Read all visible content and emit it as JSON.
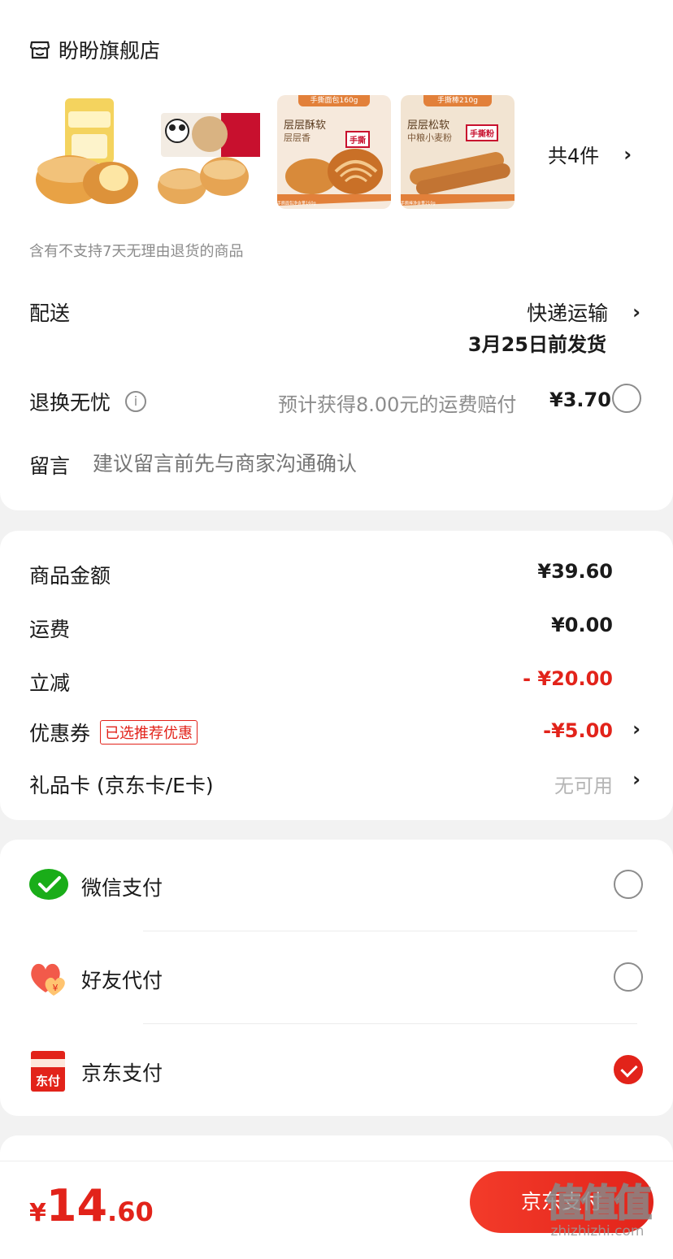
{
  "store": {
    "name": "盼盼旗舰店",
    "icon": "store-icon"
  },
  "products": {
    "items": [
      {
        "name": "product-thumb-1"
      },
      {
        "name": "product-thumb-2"
      },
      {
        "name": "product-thumb-3",
        "tag": "手撕面包160g",
        "line1": "层层酥软",
        "line2": "层层香",
        "brand": "手撕",
        "weight": "手撕面包净含量160g"
      },
      {
        "name": "product-thumb-4",
        "tag": "手撕棒210g",
        "line1": "层层松软",
        "line2": "中粮小麦粉",
        "brand": "手撕粉",
        "weight": "手撕棒净含量210g"
      }
    ],
    "count_label": "共4件"
  },
  "notice": "含有不支持7天无理由退货的商品",
  "delivery": {
    "label": "配送",
    "method": "快递运输",
    "ship_date": "3月25日前发货"
  },
  "return_insurance": {
    "label": "退换无忧",
    "desc": "预计获得8.00元的运费赔付",
    "price": "¥3.70"
  },
  "message": {
    "label": "留言",
    "placeholder": "建议留言前先与商家沟通确认"
  },
  "summary": {
    "goods_label": "商品金额",
    "goods_value": "¥39.60",
    "shipping_label": "运费",
    "shipping_value": "¥0.00",
    "discount_label": "立减",
    "discount_value": "- ¥20.00",
    "coupon_label": "优惠券",
    "coupon_badge": "已选推荐优惠",
    "coupon_value": "-¥5.00",
    "giftcard_label": "礼品卡 (京东卡/E卡)",
    "giftcard_value": "无可用"
  },
  "payment": {
    "options": [
      {
        "label": "微信支付",
        "icon": "wechat-pay-icon",
        "selected": false
      },
      {
        "label": "好友代付",
        "icon": "friend-pay-icon",
        "selected": false
      },
      {
        "label": "京东支付",
        "icon": "jd-pay-icon",
        "icon_text": "东付",
        "selected": true
      }
    ]
  },
  "footer": {
    "currency": "¥",
    "total_int": "14",
    "total_dec": ".60",
    "pay_button": "京东支付",
    "watermark": "值值值",
    "watermark_url": "zhizhizhi.com"
  },
  "colors": {
    "accent": "#e2231a",
    "background": "#f2f2f2",
    "card": "#ffffff"
  }
}
